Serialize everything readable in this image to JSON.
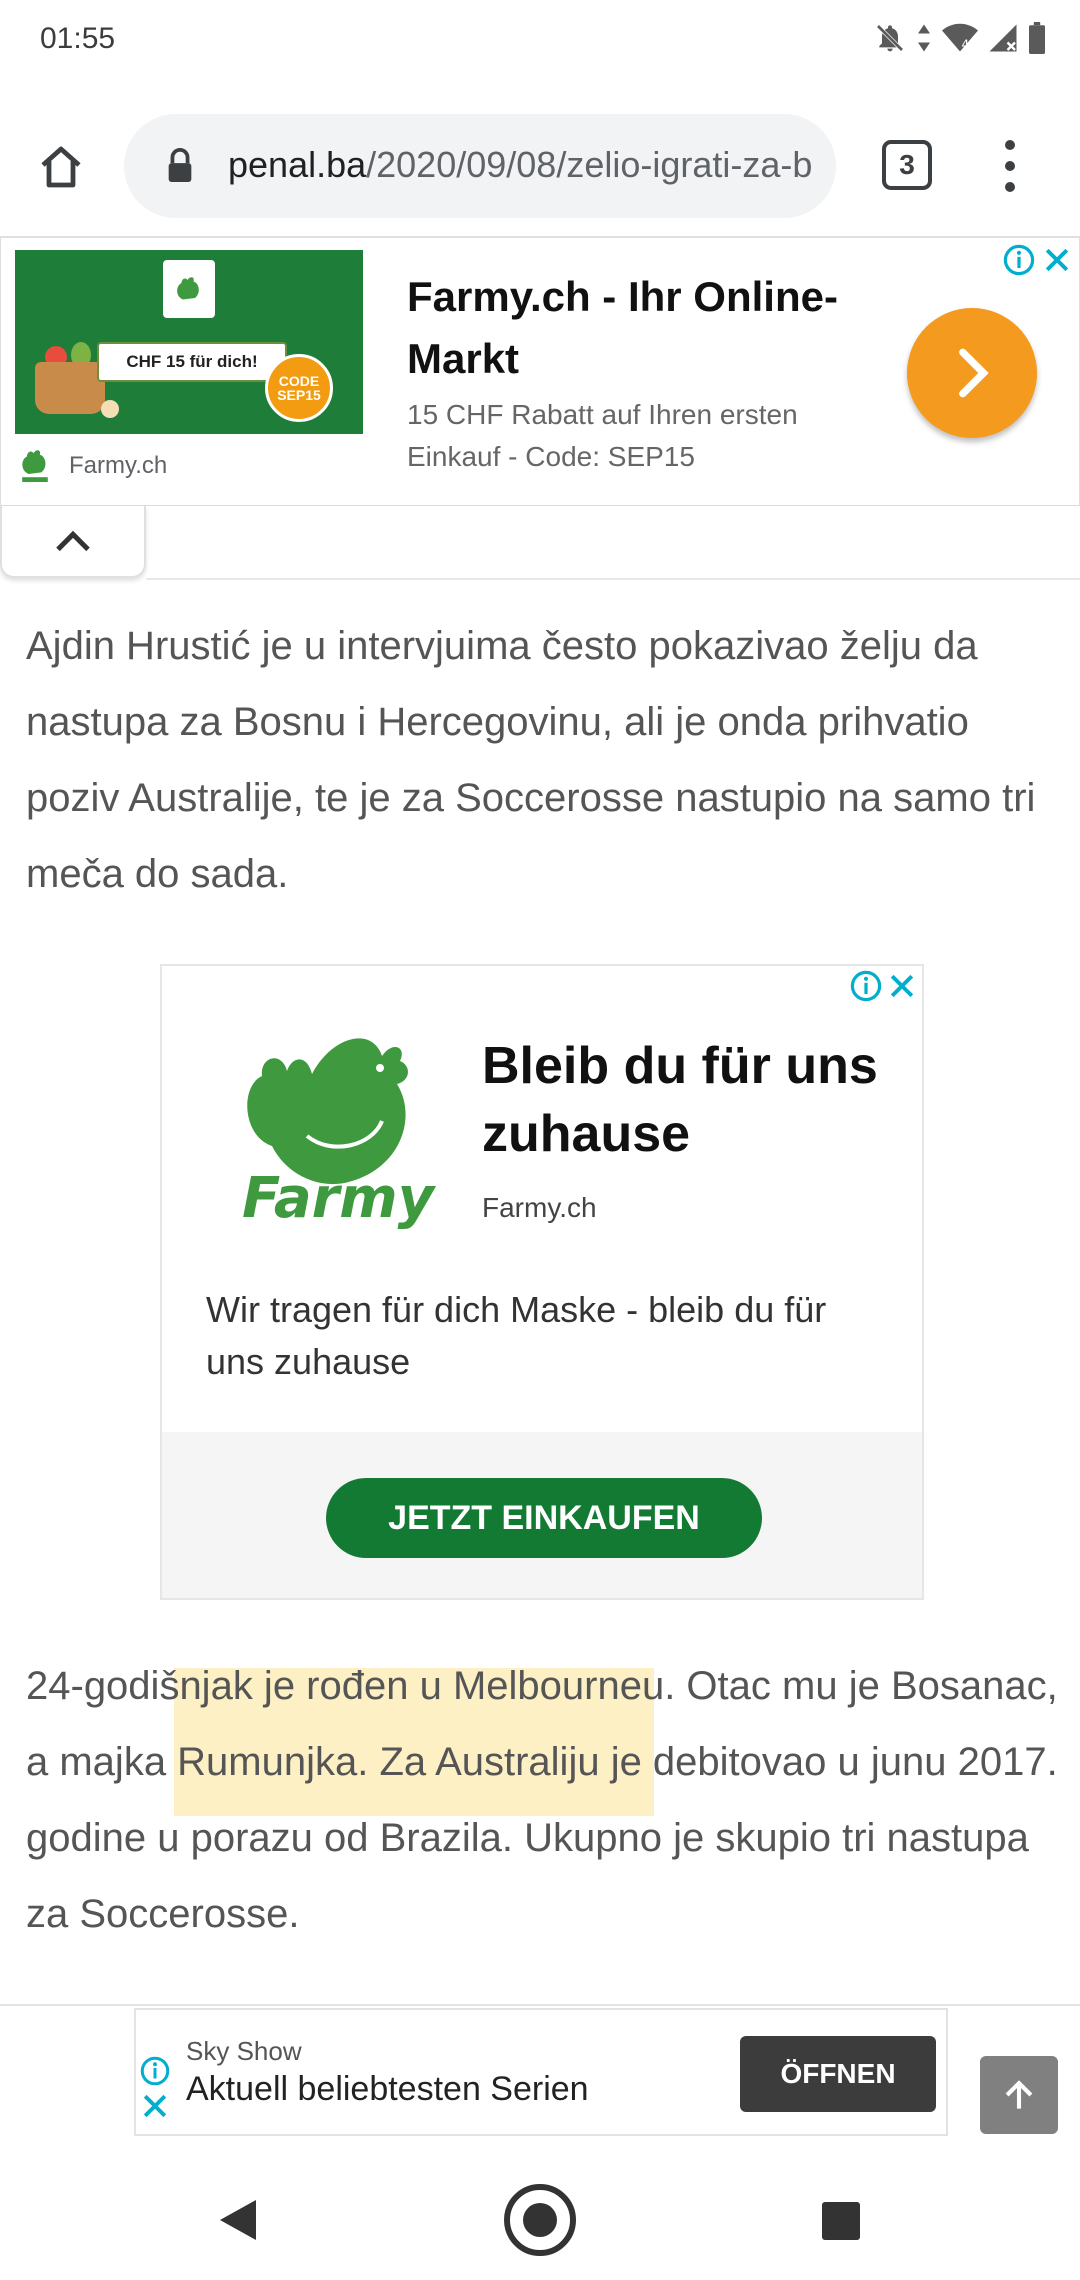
{
  "status_bar": {
    "time": "01:55",
    "icons": [
      "notifications-off-icon",
      "data-arrows-icon",
      "wifi-icon",
      "signal-icon",
      "battery-icon"
    ]
  },
  "browser": {
    "url_domain": "penal.ba",
    "url_path": "/2020/09/08/zelio-igrati-za-b",
    "tab_count": "3"
  },
  "ad_top": {
    "coupon_text": "CHF 15 für dich!",
    "code_badge": "CODE SEP15",
    "tag_label": "Farmy",
    "headline": "Farmy.ch - Ihr Online-Markt",
    "description": "15 CHF Rabatt auf Ihren ersten Einkauf - Code: SEP15",
    "advertiser": "Farmy.ch",
    "accent_color": "#f39a1f"
  },
  "article": {
    "paragraph1": "Ajdin Hrustić je u intervjuima često pokazivao želju da nastupa za Bosnu i Hercegovinu, ali je onda prihvatio poziv Australije, te je za Soccerosse nastupio na samo tri meča do sada.",
    "paragraph2": "24-godišnjak je rođen u Melbourneu. Otac mu je Bosanac, a majka Rumunjka. Za Australiju je debitovao u junu 2017. godine u porazu od Brazila. Ukupno je skupio tri nastupa za Soccerosse."
  },
  "ad_mid": {
    "logo_text": "Farmy",
    "title": "Bleib du für uns zuhause",
    "advertiser": "Farmy.ch",
    "body": "Wir tragen für dich Maske - bleib du für uns zuhause",
    "cta": "JETZT EINKAUFEN",
    "brand_color": "#137a33"
  },
  "ad_bottom": {
    "advertiser": "Sky Show",
    "tagline": "Aktuell beliebtesten Serien",
    "cta": "ÖFFNEN"
  }
}
